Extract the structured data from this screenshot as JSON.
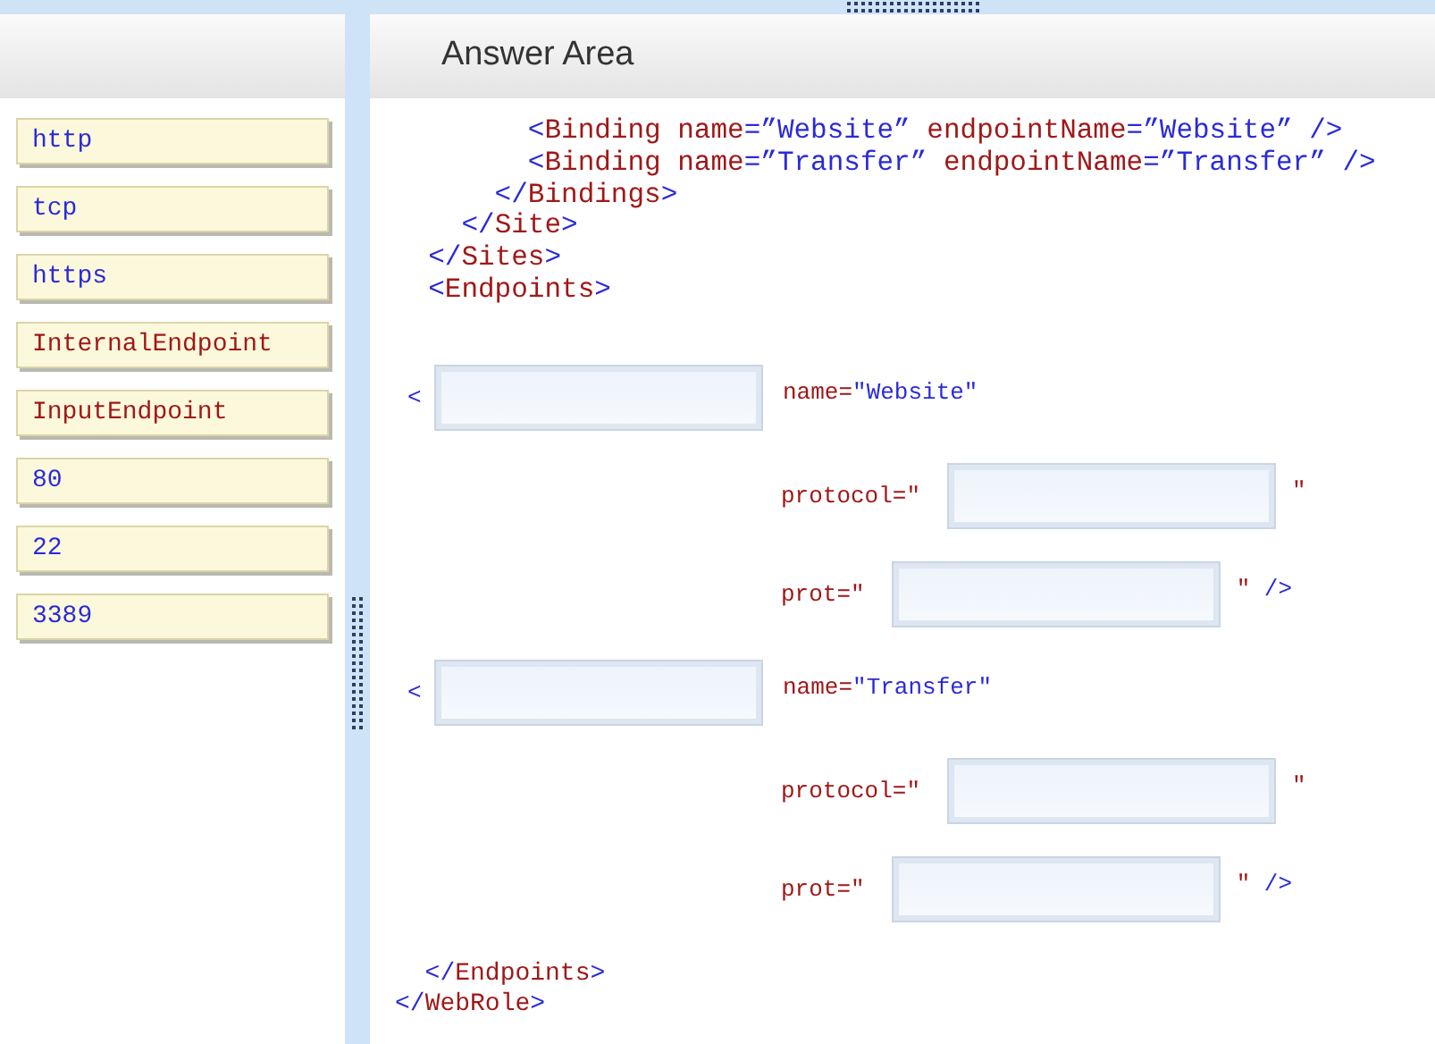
{
  "options": [
    {
      "label": "http",
      "kind": "value"
    },
    {
      "label": "tcp",
      "kind": "value"
    },
    {
      "label": "https",
      "kind": "value"
    },
    {
      "label": "InternalEndpoint",
      "kind": "element"
    },
    {
      "label": "InputEndpoint",
      "kind": "element"
    },
    {
      "label": "80",
      "kind": "value"
    },
    {
      "label": "22",
      "kind": "value"
    },
    {
      "label": "3389",
      "kind": "value"
    }
  ],
  "answer_area": {
    "title": "Answer Area",
    "code_before": [
      [
        {
          "text": "        <",
          "kind": "punct"
        },
        {
          "text": "Binding name",
          "kind": "name"
        },
        {
          "text": "=”Website” ",
          "kind": "value"
        },
        {
          "text": "endpointName",
          "kind": "name"
        },
        {
          "text": "=”Website” />",
          "kind": "value"
        }
      ],
      [
        {
          "text": "        <",
          "kind": "punct"
        },
        {
          "text": "Binding name",
          "kind": "name"
        },
        {
          "text": "=”Transfer” ",
          "kind": "value"
        },
        {
          "text": "endpointName",
          "kind": "name"
        },
        {
          "text": "=”Transfer” />",
          "kind": "value"
        }
      ],
      [
        {
          "text": "      </",
          "kind": "punct"
        },
        {
          "text": "Bindings",
          "kind": "name"
        },
        {
          "text": ">",
          "kind": "punct"
        }
      ],
      [
        {
          "text": "    </",
          "kind": "punct"
        },
        {
          "text": "Site",
          "kind": "name"
        },
        {
          "text": ">",
          "kind": "punct"
        }
      ],
      [
        {
          "text": "  </",
          "kind": "punct"
        },
        {
          "text": "Sites",
          "kind": "name"
        },
        {
          "text": ">",
          "kind": "punct"
        }
      ],
      [
        {
          "text": "  <",
          "kind": "punct"
        },
        {
          "text": "Endpoints",
          "kind": "name"
        },
        {
          "text": ">",
          "kind": "punct"
        }
      ]
    ],
    "slots": [
      {
        "kind": "element",
        "before": [
          {
            "text": "<",
            "kind": "punct"
          }
        ],
        "after": [
          {
            "text": "name=",
            "kind": "name"
          },
          {
            "text": "″Website″",
            "kind": "value"
          }
        ]
      },
      {
        "kind": "attribute",
        "before": [
          {
            "text": "protocol=″",
            "kind": "name"
          }
        ],
        "after": [
          {
            "text": "″",
            "kind": "name"
          }
        ]
      },
      {
        "kind": "attribute",
        "before": [
          {
            "text": "prot=″",
            "kind": "name"
          }
        ],
        "after": [
          {
            "text": "″",
            "kind": "name"
          },
          {
            "text": " />",
            "kind": "value"
          }
        ]
      },
      {
        "kind": "element",
        "before": [
          {
            "text": "<",
            "kind": "punct"
          }
        ],
        "after": [
          {
            "text": "name=",
            "kind": "name"
          },
          {
            "text": "″Transfer″",
            "kind": "value"
          }
        ]
      },
      {
        "kind": "attribute",
        "before": [
          {
            "text": "protocol=″",
            "kind": "name"
          }
        ],
        "after": [
          {
            "text": "″",
            "kind": "name"
          }
        ]
      },
      {
        "kind": "attribute",
        "before": [
          {
            "text": "prot=″",
            "kind": "name"
          }
        ],
        "after": [
          {
            "text": "″",
            "kind": "name"
          },
          {
            "text": " />",
            "kind": "value"
          }
        ]
      }
    ],
    "code_after": [
      [
        {
          "text": "  </",
          "kind": "punct"
        },
        {
          "text": "Endpoints",
          "kind": "name"
        },
        {
          "text": ">",
          "kind": "punct"
        }
      ],
      [
        {
          "text": "</",
          "kind": "punct"
        },
        {
          "text": "WebRole",
          "kind": "name"
        },
        {
          "text": ">",
          "kind": "punct"
        }
      ]
    ]
  }
}
